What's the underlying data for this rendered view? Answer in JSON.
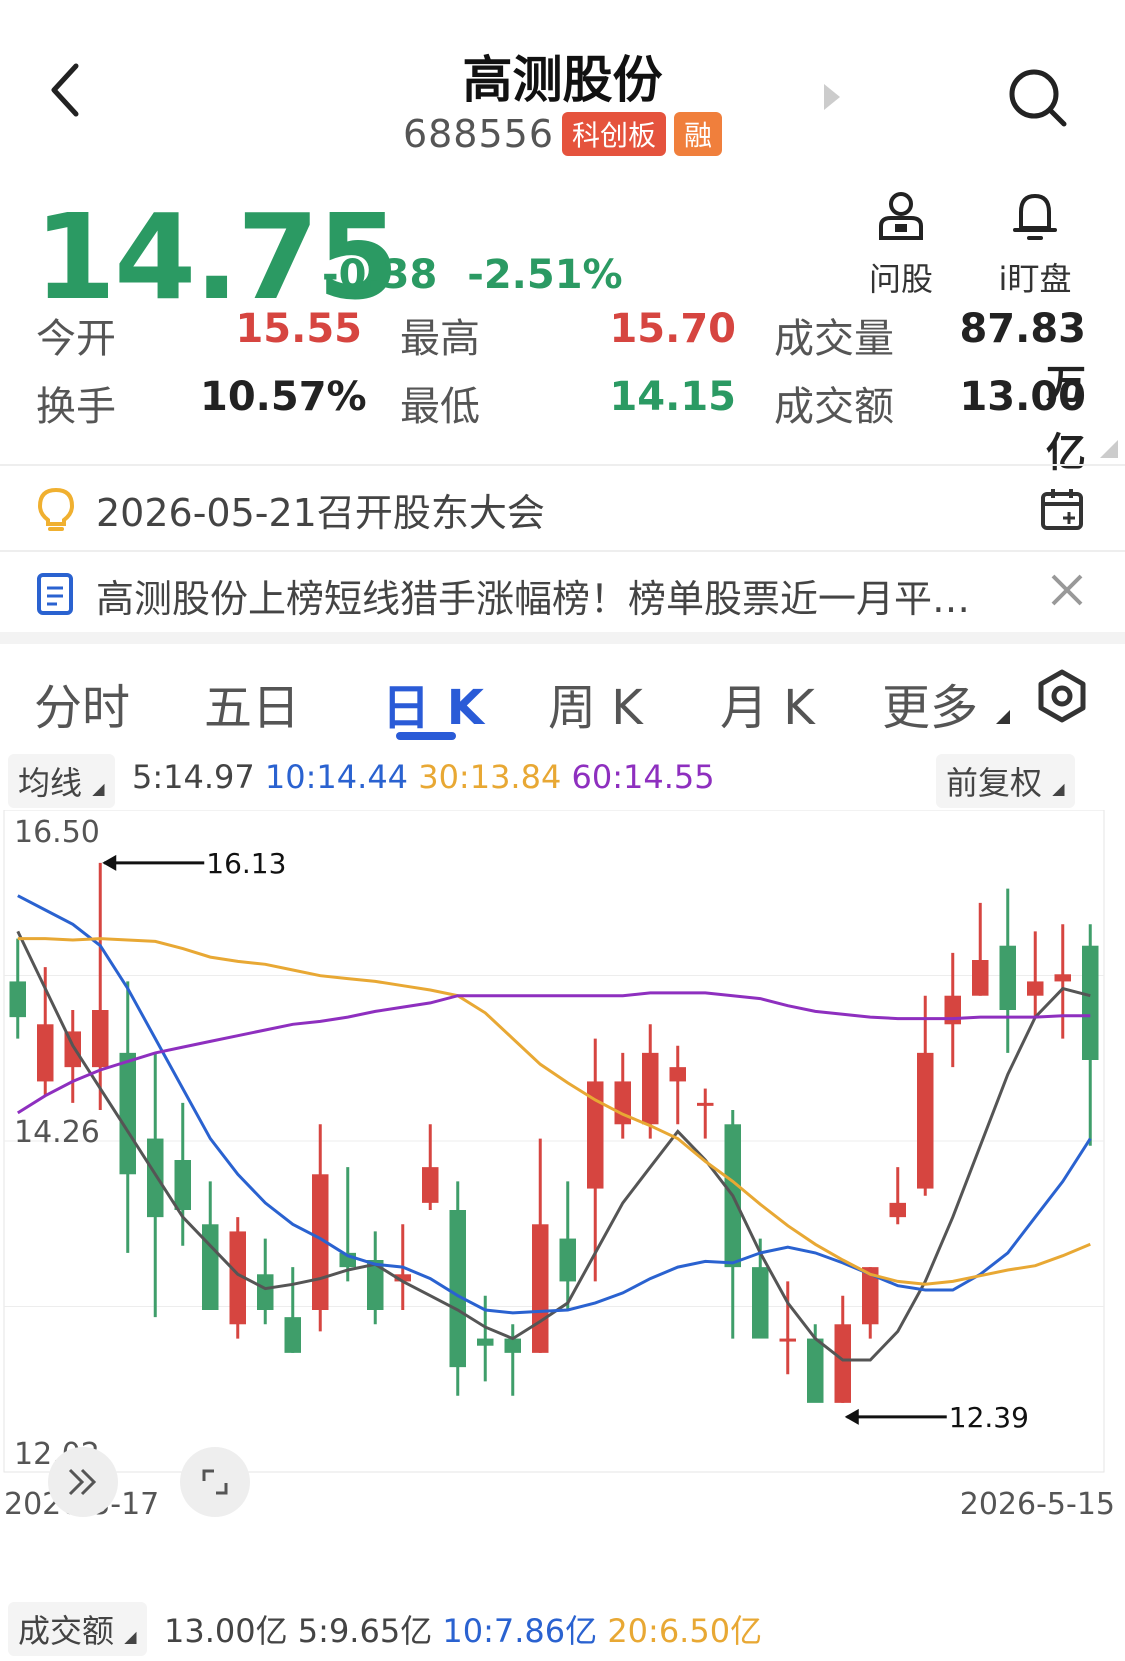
{
  "header": {
    "title": "高测股份",
    "code": "688556",
    "tag_board": "科创板",
    "tag_margin": "融"
  },
  "quote": {
    "price": "14.75",
    "change": "-0.38",
    "change_pct": "-2.51%",
    "actions": [
      {
        "label": "问股",
        "icon": "person-question-icon"
      },
      {
        "label": "i盯盘",
        "icon": "bell-icon"
      }
    ]
  },
  "stats": {
    "open_label": "今开",
    "open_value": "15.55",
    "high_label": "最高",
    "high_value": "15.70",
    "volume_label": "成交量",
    "volume_value": "87.83万",
    "turnover_label": "换手",
    "turnover_value": "10.57%",
    "low_label": "最低",
    "low_value": "14.15",
    "amount_label": "成交额",
    "amount_value": "13.00亿"
  },
  "notices": [
    {
      "text": "2026-05-21召开股东大会",
      "icon": "lightbulb-icon",
      "right_icon": "calendar-add-icon"
    },
    {
      "text": "高测股份上榜短线猎手涨幅榜！榜单股票近一月平…",
      "icon": "document-icon",
      "right_icon": "close-icon"
    }
  ],
  "tabs": [
    {
      "label": "分时",
      "active": false
    },
    {
      "label": "五日",
      "active": false
    },
    {
      "label": "日 K",
      "active": true
    },
    {
      "label": "周 K",
      "active": false
    },
    {
      "label": "月 K",
      "active": false
    },
    {
      "label": "更多",
      "active": false
    }
  ],
  "indicators": {
    "ma_dropdown": "均线",
    "ma5": "5:14.97",
    "ma10": "10:14.44",
    "ma30": "30:13.84",
    "ma60": "60:14.55",
    "adjust_dropdown": "前复权"
  },
  "chart_data": {
    "type": "candlestick",
    "y_axis_labels": [
      "16.50",
      "14.26",
      "12.02"
    ],
    "ylim": [
      12.02,
      16.5
    ],
    "x_start": "2026-3-17",
    "x_end": "2026-5-15",
    "max_annotation": "16.13",
    "min_annotation": "12.39",
    "colors": {
      "up": "#d64540",
      "down": "#3f9e6a",
      "ma5": "#555555",
      "ma10": "#2a62d0",
      "ma30": "#e8a834",
      "ma60": "#8e2fbf"
    },
    "candles": [
      {
        "o": 15.3,
        "h": 15.6,
        "l": 14.9,
        "c": 15.05
      },
      {
        "o": 14.6,
        "h": 15.4,
        "l": 14.5,
        "c": 15.0
      },
      {
        "o": 14.7,
        "h": 15.1,
        "l": 14.45,
        "c": 14.95
      },
      {
        "o": 14.7,
        "h": 16.13,
        "l": 14.4,
        "c": 15.1
      },
      {
        "o": 14.8,
        "h": 15.3,
        "l": 13.4,
        "c": 13.95
      },
      {
        "o": 14.2,
        "h": 14.8,
        "l": 12.95,
        "c": 13.65
      },
      {
        "o": 14.05,
        "h": 14.45,
        "l": 13.45,
        "c": 13.7
      },
      {
        "o": 13.6,
        "h": 13.9,
        "l": 13.1,
        "c": 13.0
      },
      {
        "o": 12.9,
        "h": 13.65,
        "l": 12.8,
        "c": 13.55
      },
      {
        "o": 13.25,
        "h": 13.5,
        "l": 12.9,
        "c": 13.0
      },
      {
        "o": 12.95,
        "h": 13.3,
        "l": 12.7,
        "c": 12.7
      },
      {
        "o": 13.0,
        "h": 14.3,
        "l": 12.85,
        "c": 13.95
      },
      {
        "o": 13.4,
        "h": 14.0,
        "l": 13.2,
        "c": 13.3
      },
      {
        "o": 13.35,
        "h": 13.55,
        "l": 12.9,
        "c": 13.0
      },
      {
        "o": 13.2,
        "h": 13.6,
        "l": 13.0,
        "c": 13.25
      },
      {
        "o": 13.75,
        "h": 14.3,
        "l": 13.7,
        "c": 14.0
      },
      {
        "o": 13.7,
        "h": 13.9,
        "l": 12.4,
        "c": 12.6
      },
      {
        "o": 12.8,
        "h": 13.1,
        "l": 12.5,
        "c": 12.75
      },
      {
        "o": 12.8,
        "h": 12.9,
        "l": 12.4,
        "c": 12.7
      },
      {
        "o": 12.7,
        "h": 14.2,
        "l": 12.7,
        "c": 13.6
      },
      {
        "o": 13.5,
        "h": 13.9,
        "l": 13.0,
        "c": 13.2
      },
      {
        "o": 13.85,
        "h": 14.9,
        "l": 13.2,
        "c": 14.6
      },
      {
        "o": 14.3,
        "h": 14.8,
        "l": 14.2,
        "c": 14.6
      },
      {
        "o": 14.3,
        "h": 15.0,
        "l": 14.2,
        "c": 14.8
      },
      {
        "o": 14.6,
        "h": 14.85,
        "l": 14.3,
        "c": 14.7
      },
      {
        "o": 14.45,
        "h": 14.55,
        "l": 14.2,
        "c": 14.45
      },
      {
        "o": 14.3,
        "h": 14.4,
        "l": 12.8,
        "c": 13.3
      },
      {
        "o": 13.3,
        "h": 13.5,
        "l": 12.9,
        "c": 12.8
      },
      {
        "o": 12.8,
        "h": 13.2,
        "l": 12.55,
        "c": 12.8
      },
      {
        "o": 12.8,
        "h": 12.9,
        "l": 12.39,
        "c": 12.35
      },
      {
        "o": 12.35,
        "h": 13.1,
        "l": 12.35,
        "c": 12.9
      },
      {
        "o": 12.9,
        "h": 13.3,
        "l": 12.8,
        "c": 13.3
      },
      {
        "o": 13.65,
        "h": 14.0,
        "l": 13.6,
        "c": 13.75
      },
      {
        "o": 13.85,
        "h": 15.2,
        "l": 13.8,
        "c": 14.8
      },
      {
        "o": 15.0,
        "h": 15.5,
        "l": 14.7,
        "c": 15.2
      },
      {
        "o": 15.2,
        "h": 15.85,
        "l": 15.2,
        "c": 15.45
      },
      {
        "o": 15.55,
        "h": 15.95,
        "l": 14.8,
        "c": 15.1
      },
      {
        "o": 15.2,
        "h": 15.65,
        "l": 15.05,
        "c": 15.3
      },
      {
        "o": 15.3,
        "h": 15.7,
        "l": 14.9,
        "c": 15.35
      },
      {
        "o": 15.55,
        "h": 15.7,
        "l": 14.15,
        "c": 14.75
      }
    ],
    "ma_series": [
      {
        "name": "ma5",
        "values": [
          15.65,
          15.25,
          14.85,
          14.55,
          14.25,
          13.95,
          13.65,
          13.45,
          13.25,
          13.15,
          13.18,
          13.22,
          13.28,
          13.32,
          13.2,
          13.1,
          13.0,
          12.88,
          12.8,
          12.92,
          13.05,
          13.4,
          13.75,
          14.0,
          14.25,
          14.05,
          13.8,
          13.4,
          13.05,
          12.8,
          12.65,
          12.65,
          12.85,
          13.2,
          13.65,
          14.15,
          14.65,
          15.05,
          15.25,
          15.2
        ]
      },
      {
        "name": "ma10",
        "values": [
          15.9,
          15.8,
          15.7,
          15.55,
          15.25,
          14.9,
          14.55,
          14.2,
          13.95,
          13.75,
          13.6,
          13.5,
          13.38,
          13.32,
          13.3,
          13.22,
          13.1,
          13.0,
          12.98,
          12.99,
          13.0,
          13.05,
          13.12,
          13.22,
          13.3,
          13.34,
          13.33,
          13.4,
          13.44,
          13.4,
          13.33,
          13.25,
          13.17,
          13.14,
          13.14,
          13.25,
          13.4,
          13.65,
          13.9,
          14.2
        ]
      },
      {
        "name": "ma30",
        "values": [
          15.6,
          15.6,
          15.59,
          15.6,
          15.59,
          15.58,
          15.53,
          15.47,
          15.44,
          15.42,
          15.38,
          15.34,
          15.32,
          15.3,
          15.27,
          15.24,
          15.2,
          15.08,
          14.9,
          14.72,
          14.59,
          14.47,
          14.37,
          14.29,
          14.2,
          14.04,
          13.9,
          13.74,
          13.59,
          13.46,
          13.35,
          13.25,
          13.2,
          13.18,
          13.2,
          13.24,
          13.28,
          13.31,
          13.38,
          13.46
        ]
      },
      {
        "name": "ma60",
        "values": [
          14.38,
          14.5,
          14.6,
          14.68,
          14.74,
          14.8,
          14.84,
          14.88,
          14.92,
          14.96,
          15.0,
          15.02,
          15.05,
          15.09,
          15.12,
          15.15,
          15.2,
          15.2,
          15.2,
          15.2,
          15.2,
          15.2,
          15.2,
          15.22,
          15.22,
          15.22,
          15.2,
          15.18,
          15.13,
          15.09,
          15.07,
          15.05,
          15.04,
          15.04,
          15.04,
          15.05,
          15.05,
          15.05,
          15.06,
          15.06
        ]
      }
    ]
  },
  "volume_bar": {
    "dropdown": "成交额",
    "value": "13.00亿",
    "ma5": "5:9.65亿",
    "ma10": "10:7.86亿",
    "ma20": "20:6.50亿"
  }
}
